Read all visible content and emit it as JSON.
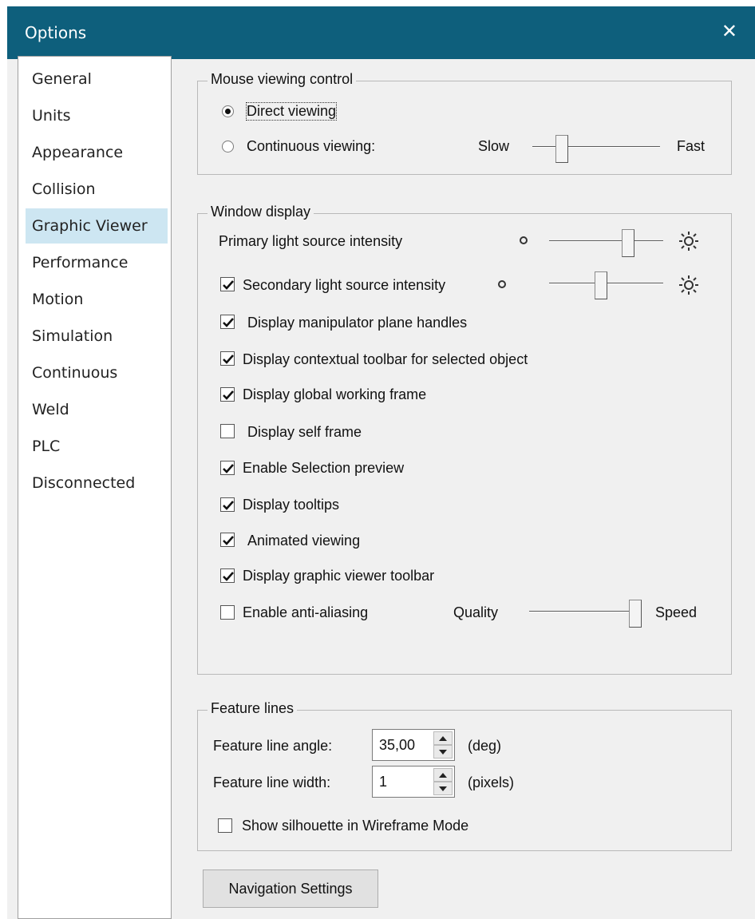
{
  "window": {
    "title": "Options",
    "close_glyph": "✕"
  },
  "sidebar": {
    "items": [
      {
        "label": "General"
      },
      {
        "label": "Units"
      },
      {
        "label": "Appearance"
      },
      {
        "label": "Collision"
      },
      {
        "label": "Graphic Viewer",
        "selected": true
      },
      {
        "label": "Performance"
      },
      {
        "label": "Motion"
      },
      {
        "label": "Simulation"
      },
      {
        "label": "Continuous"
      },
      {
        "label": "Weld"
      },
      {
        "label": "PLC"
      },
      {
        "label": "Disconnected"
      }
    ]
  },
  "mouse_viewing": {
    "title": "Mouse viewing control",
    "direct_label": "Direct viewing",
    "continuous_label": "Continuous viewing:",
    "selected": "direct",
    "speed_min_label": "Slow",
    "speed_max_label": "Fast",
    "speed_level": 0.2
  },
  "window_display": {
    "title": "Window display",
    "primary_light_label": "Primary light source intensity",
    "primary_light_level": 0.72,
    "secondary_light_label": "Secondary light source intensity",
    "secondary_light_checked": true,
    "secondary_light_level": 0.45,
    "manipulator_label": "Display manipulator plane handles",
    "manipulator_checked": true,
    "contextual_label": "Display contextual toolbar for selected object",
    "contextual_checked": true,
    "global_frame_label": "Display global working frame",
    "global_frame_checked": true,
    "self_frame_label": "Display self frame",
    "self_frame_checked": false,
    "selection_preview_label": "Enable Selection preview",
    "selection_preview_checked": true,
    "tooltips_label": "Display tooltips",
    "tooltips_checked": true,
    "animated_label": "Animated viewing",
    "animated_checked": true,
    "gv_toolbar_label": "Display graphic viewer toolbar",
    "gv_toolbar_checked": true,
    "antialias_label": "Enable anti-aliasing",
    "antialias_checked": false,
    "quality_label": "Quality",
    "speed_label": "Speed",
    "quality_level": 1.0
  },
  "feature_lines": {
    "title": "Feature lines",
    "angle_label": "Feature line angle:",
    "angle_value": "35,00",
    "angle_unit": "(deg)",
    "width_label": "Feature line width:",
    "width_value": "1",
    "width_unit": "(pixels)",
    "silhouette_label": "Show silhouette in Wireframe Mode",
    "silhouette_checked": false
  },
  "navigation_button": "Navigation Settings",
  "colors": {
    "titlebar": "#0e5f7c",
    "selected_item": "#cde6f2",
    "dialog_bg": "#f0f0f0"
  }
}
